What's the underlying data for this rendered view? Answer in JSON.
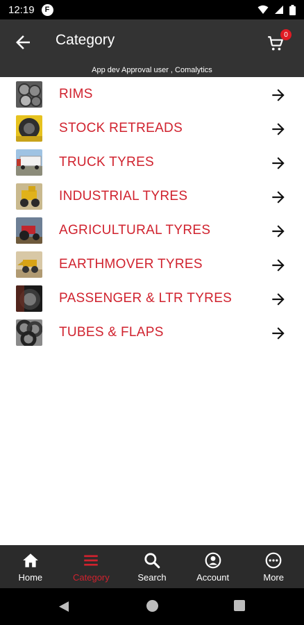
{
  "status_bar": {
    "time": "12:19",
    "notif_glyph": "F"
  },
  "app_bar": {
    "title": "Category",
    "cart_count": "0"
  },
  "user_strip": "App dev Approval user , Comalytics",
  "categories": [
    {
      "label": "RIMS",
      "icon": "rims-thumbnail"
    },
    {
      "label": "STOCK RETREADS",
      "icon": "stock-retreads-thumbnail"
    },
    {
      "label": "TRUCK TYRES",
      "icon": "truck-tyres-thumbnail"
    },
    {
      "label": "INDUSTRIAL TYRES",
      "icon": "industrial-tyres-thumbnail"
    },
    {
      "label": "AGRICULTURAL TYRES",
      "icon": "agricultural-tyres-thumbnail"
    },
    {
      "label": "EARTHMOVER TYRES",
      "icon": "earthmover-tyres-thumbnail"
    },
    {
      "label": "PASSENGER & LTR TYRES",
      "icon": "passenger-tyres-thumbnail"
    },
    {
      "label": "TUBES & FLAPS",
      "icon": "tubes-flaps-thumbnail"
    }
  ],
  "bottom_nav": [
    {
      "label": "Home",
      "icon": "home-icon"
    },
    {
      "label": "Category",
      "icon": "menu-icon",
      "active": true
    },
    {
      "label": "Search",
      "icon": "search-icon"
    },
    {
      "label": "Account",
      "icon": "account-icon"
    },
    {
      "label": "More",
      "icon": "more-icon"
    }
  ],
  "colors": {
    "accent": "#d0222e",
    "app_bar": "#333333",
    "bottom_nav": "#2b2b2b"
  }
}
